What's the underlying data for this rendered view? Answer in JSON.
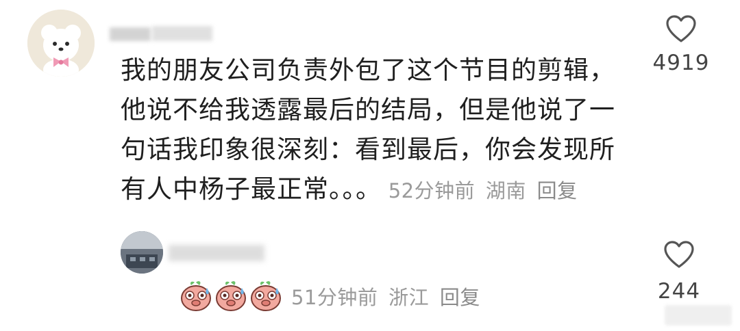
{
  "comment_1": {
    "lines": [
      "我的朋友公司负责外包了这个节目的剪辑，",
      "他说不给我透露最后的结局，但是他说了一",
      "句话我印象很深刻：看到最后，你会发现所",
      "有人中杨子最正常。。。"
    ],
    "time": "52分钟前",
    "location": "湖南",
    "reply": "回复",
    "likes": "4919",
    "like_icon": "heart-outline-icon"
  },
  "comment_2": {
    "emoji_icon": "pig-sweat-emoji",
    "emoji_count": 3,
    "time": "51分钟前",
    "location": "浙江",
    "reply": "回复",
    "likes": "244",
    "like_icon": "heart-outline-icon"
  },
  "colors": {
    "text": "#1f1f1f",
    "meta": "#9a9a9a",
    "background": "#ffffff",
    "emoji_pink": "#f0a8a0"
  }
}
